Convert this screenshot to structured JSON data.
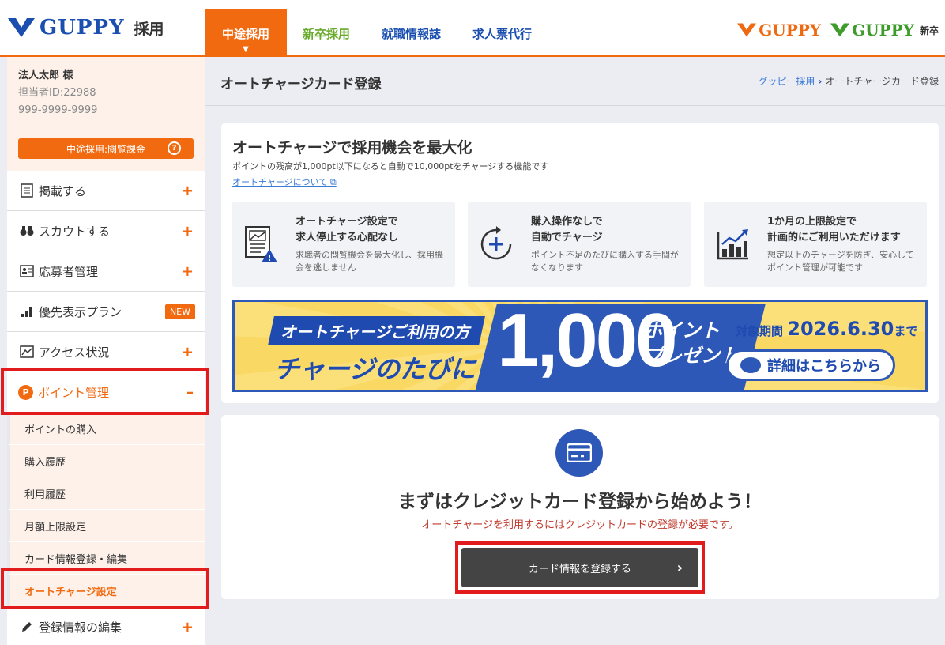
{
  "header": {
    "logo_text": "GUPPY",
    "logo_sub": "採用",
    "tabs": [
      {
        "label": "中途採用"
      },
      {
        "label": "新卒採用"
      },
      {
        "label": "就職情報誌"
      },
      {
        "label": "求人票代行"
      }
    ],
    "brands": [
      {
        "label": "GUPPY"
      },
      {
        "label": "GUPPY",
        "sup": "新卒"
      }
    ],
    "colors": {
      "accent": "#f26a10",
      "brand_blue": "#1a4fb0",
      "green": "#6aab2e"
    }
  },
  "sidebar": {
    "profile": {
      "name": "法人太郎 様",
      "staff_id": "担当者ID:22988",
      "phone": "999-9999-9999",
      "plan_label": "中途採用:閲覧課金",
      "help_glyph": "?"
    },
    "items": [
      {
        "label": "掲載する",
        "icon": "document-icon",
        "toggle": "+"
      },
      {
        "label": "スカウトする",
        "icon": "binoculars-icon",
        "toggle": "+"
      },
      {
        "label": "応募者管理",
        "icon": "applicant-card-icon",
        "toggle": "+"
      },
      {
        "label": "優先表示プラン",
        "icon": "bar-chart-icon",
        "badge": "NEW"
      },
      {
        "label": "アクセス状況",
        "icon": "access-chart-icon",
        "toggle": "+"
      },
      {
        "label": "ポイント管理",
        "icon": "point-icon",
        "icon_glyph": "P",
        "toggle": "–"
      },
      {
        "label": "登録情報の編集",
        "icon": "pencil-icon",
        "toggle": "+"
      }
    ],
    "point_sub_items": [
      {
        "label": "ポイントの購入"
      },
      {
        "label": "購入履歴"
      },
      {
        "label": "利用履歴"
      },
      {
        "label": "月額上限設定"
      },
      {
        "label": "カード情報登録・編集"
      },
      {
        "label": "オートチャージ設定"
      }
    ]
  },
  "page": {
    "title": "オートチャージカード登録",
    "breadcrumb": {
      "link": "グッピー採用",
      "current": "オートチャージカード登録"
    }
  },
  "intro": {
    "title": "オートチャージで採用機会を最大化",
    "desc": "ポイントの残高が1,000pt以下になると自動で10,000ptをチャージする機能です",
    "link": "オートチャージについて",
    "features": [
      {
        "title1": "オートチャージ設定で",
        "title2": "求人停止する心配なし",
        "desc": "求職者の閲覧機会を最大化し、採用機会を逃しません",
        "icon": "document-warning-icon"
      },
      {
        "title1": "購入操作なしで",
        "title2": "自動でチャージ",
        "desc": "ポイント不足のたびに購入する手間がなくなります",
        "icon": "refresh-plus-icon"
      },
      {
        "title1": "1か月の上限設定で",
        "title2": "計画的にご利用いただけます",
        "desc": "想定以上のチャージを防ぎ、安心してポイント管理が可能です",
        "icon": "growth-chart-icon"
      }
    ]
  },
  "banner": {
    "line1": "オートチャージご利用の方",
    "line2": "チャージのたびに",
    "amount": "1,000",
    "point_label1": "ポイント",
    "point_label2": "プレゼント",
    "period_label": "対象期間",
    "period_date": "2026.6.30",
    "period_suffix": "まで",
    "button": "詳細はこちらから"
  },
  "register": {
    "title": "まずはクレジットカード登録から始めよう！",
    "warning": "オートチャージを利用するにはクレジットカードの登録が必要です。",
    "button": "カード情報を登録する"
  }
}
